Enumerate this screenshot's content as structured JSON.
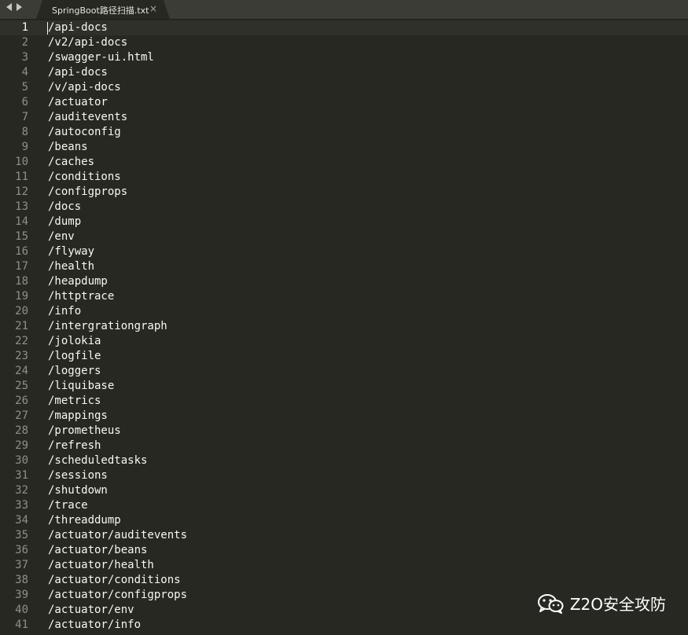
{
  "tabbar": {
    "back_icon": "triangle-left-icon",
    "forward_icon": "triangle-right-icon",
    "tab_title": "SpringBoot路径扫描.txt",
    "close_glyph": "×"
  },
  "editor": {
    "lines": [
      "/api-docs",
      "/v2/api-docs",
      "/swagger-ui.html",
      "/api-docs",
      "/v/api-docs",
      "/actuator",
      "/auditevents",
      "/autoconfig",
      "/beans",
      "/caches",
      "/conditions",
      "/configprops",
      "/docs",
      "/dump",
      "/env",
      "/flyway",
      "/health",
      "/heapdump",
      "/httptrace",
      "/info",
      "/intergrationgraph",
      "/jolokia",
      "/logfile",
      "/loggers",
      "/liquibase",
      "/metrics",
      "/mappings",
      "/prometheus",
      "/refresh",
      "/scheduledtasks",
      "/sessions",
      "/shutdown",
      "/trace",
      "/threaddump",
      "/actuator/auditevents",
      "/actuator/beans",
      "/actuator/health",
      "/actuator/conditions",
      "/actuator/configprops",
      "/actuator/env",
      "/actuator/info"
    ]
  },
  "watermark": {
    "text": "Z2O安全攻防",
    "icon": "wechat-logo"
  },
  "colors": {
    "background": "#272822",
    "text": "#f8f8f2",
    "gutter": "#8f908a"
  }
}
